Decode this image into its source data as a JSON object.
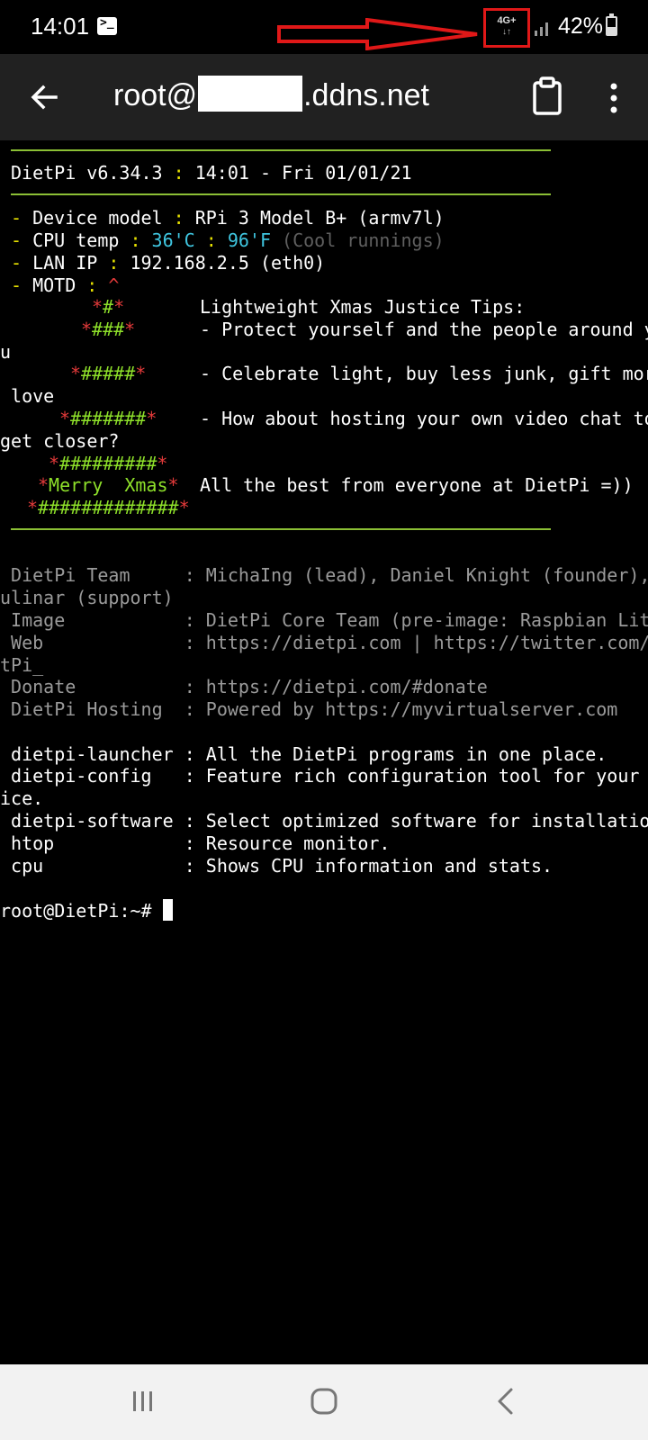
{
  "status_bar": {
    "time": "14:01",
    "terminal_notification_glyph": ">_",
    "network_type": "4G+",
    "network_activity": "↓↑",
    "battery_percent": "42%",
    "battery_level": 0.42,
    "annotation_color": "#e01818"
  },
  "toolbar": {
    "title_prefix": "root@",
    "title_suffix": ".ddns.net",
    "icons": [
      "back-arrow-icon",
      "clipboard-icon",
      "more-vert-icon"
    ]
  },
  "terminal": {
    "header_name": "DietPi v6.34.3",
    "header_sep": " : ",
    "header_datetime": "14:01 - Fri 01/01/21",
    "info": [
      {
        "dash": "-",
        "label": " Device model",
        "sep": " : ",
        "value": "RPi 3 Model B+ (armv7l)"
      },
      {
        "dash": "-",
        "label": " CPU temp",
        "sep": " : ",
        "value_c": "36'C",
        "sep2": " : ",
        "value_f": "96'F",
        "note": " (Cool runnings)"
      },
      {
        "dash": "-",
        "label": " LAN IP",
        "sep": " : ",
        "value": "192.168.2.5 (eth0)"
      },
      {
        "dash": "-",
        "label": " MOTD",
        "sep": " : ",
        "value": "^"
      }
    ],
    "motd": {
      "tree_rows": [
        "#",
        "###",
        "#####",
        "#######",
        "#########",
        "Merry  Xmas",
        "#############"
      ],
      "tips": [
        "Lightweight Xmas Justice Tips:",
        "- Protect yourself and the people around yo",
        "u",
        "- Celebrate light, buy less junk, gift more",
        " love",
        "- How about hosting your own video chat to",
        "get closer?",
        "All the best from everyone at DietPi =))"
      ]
    },
    "credits": [
      " DietPi Team     : MichaIng (lead), Daniel Knight (founder), Jo",
      "ulinar (support)",
      " Image           : DietPi Core Team (pre-image: Raspbian Lite)",
      " Web             : https://dietpi.com | https://twitter.com/Die",
      "tPi_",
      " Donate          : https://dietpi.com/#donate",
      " DietPi Hosting  : Powered by https://myvirtualserver.com"
    ],
    "commands": [
      {
        "cmd": " dietpi-launcher",
        "desc": " : All the DietPi programs in one place."
      },
      {
        "cmd": " dietpi-config  ",
        "desc": " : Feature rich configuration tool for your dev"
      },
      {
        "cmd": "",
        "desc": "ice."
      },
      {
        "cmd": " dietpi-software",
        "desc": " : Select optimized software for installation."
      },
      {
        "cmd": " htop           ",
        "desc": " : Resource monitor."
      },
      {
        "cmd": " cpu            ",
        "desc": " : Shows CPU information and stats."
      }
    ],
    "prompt": "root@DietPi:~# "
  },
  "navbar": {
    "icons": [
      "recents-icon",
      "home-icon",
      "back-icon"
    ]
  }
}
